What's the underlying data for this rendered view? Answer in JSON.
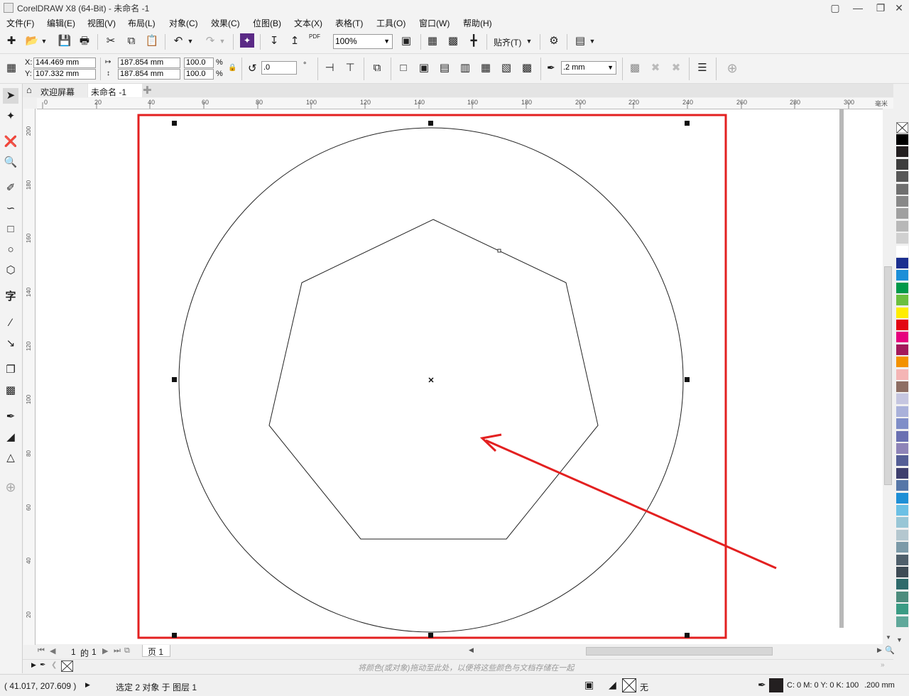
{
  "window": {
    "title": "CorelDRAW X8 (64-Bit) - 未命名 -1"
  },
  "menu": [
    "文件(F)",
    "编辑(E)",
    "视图(V)",
    "布局(L)",
    "对象(C)",
    "效果(C)",
    "位图(B)",
    "文本(X)",
    "表格(T)",
    "工具(O)",
    "窗口(W)",
    "帮助(H)"
  ],
  "toolbar": {
    "zoom": "100%",
    "snap": "贴齐(T)",
    "pdf_label": "PDF"
  },
  "properties": {
    "x_label": "X:",
    "x": "144.469 mm",
    "y_label": "Y:",
    "y": "107.332 mm",
    "width": "187.854 mm",
    "height": "187.854 mm",
    "scale_w": "100.0",
    "scale_h": "100.0",
    "pct": "%",
    "rotation": ".0",
    "degree": "°",
    "outline": ".2 mm"
  },
  "tabs": [
    {
      "label": "欢迎屏幕"
    },
    {
      "label": "未命名 -1"
    }
  ],
  "ruler": {
    "h_ticks": [
      "0",
      "20",
      "40",
      "60",
      "80",
      "100",
      "120",
      "140",
      "160",
      "180",
      "200",
      "220",
      "240",
      "260",
      "280",
      "300"
    ],
    "v_ticks": [
      "200",
      "180",
      "160",
      "140",
      "120",
      "100",
      "80",
      "60",
      "40",
      "20"
    ],
    "unit": "毫米"
  },
  "page_nav": {
    "current": "1",
    "of": "的",
    "total": "1",
    "page_tab": "页 1"
  },
  "doc_palette_hint": "将颜色(或对象)拖动至此处，以便将这些颜色与文档存储在一起",
  "status": {
    "coords": "( 41.017, 207.609 )",
    "selection": "选定 2 对象 于 图层 1",
    "fill": "无",
    "outline_color": "C: 0 M: 0 Y: 0 K: 100",
    "outline_width": ".200 mm"
  },
  "palette": [
    "#000000",
    "#231f20",
    "#3d3d3d",
    "#575757",
    "#6f6f6f",
    "#888888",
    "#a0a0a0",
    "#b8b8b8",
    "#d0d0d0",
    "#ffffff",
    "#1b2f8f",
    "#1c8fd8",
    "#00994a",
    "#6cbf3f",
    "#ffed00",
    "#e30613",
    "#e6007e",
    "#a3195b",
    "#f39200",
    "#f5b5b5",
    "#8d6e63",
    "#c5c6e0",
    "#a9b1da",
    "#7f8ec8",
    "#6a70b2",
    "#8e84b8",
    "#545e96",
    "#3e3f6e",
    "#5677a8",
    "#1e8fd6",
    "#6cc0e5",
    "#98c6d6",
    "#b4c7cf",
    "#7c9aa8",
    "#4f5f6b",
    "#3e4b55",
    "#2e6a6b",
    "#4c8c7d",
    "#3a9b84",
    "#5fa89a"
  ]
}
